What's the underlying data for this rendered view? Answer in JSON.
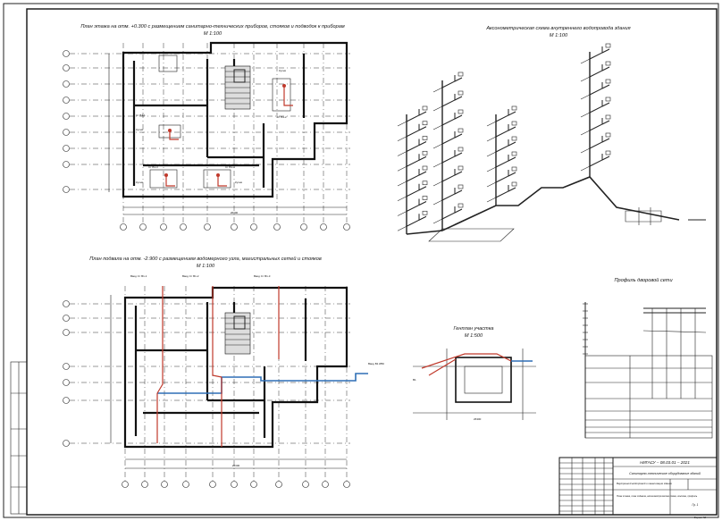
{
  "titles": {
    "floor_plan": "План этажа на отм. +0.300 с размещением санитарно-технических приборов, стояков и подводок к приборам",
    "axonometric": "Аксонометрическая схема внутреннего водопровода здания",
    "basement_plan": "План подвала на отм. -2.900 с размещением водомерного узла, магистральных сетей и стояков",
    "profile": "Профиль дворовой сети",
    "site_plan": "Генплан участка",
    "scale_100": "М 1:100",
    "scale_500": "М 1:500"
  },
  "title_block": {
    "code": "НИГАСУ – 08.03.01 – 2021",
    "subject": "Санитарно-техническое оборудование зданий",
    "part": "Внутренний водопровод и канализация здания",
    "contents": "План этажа, план подвала, аксонометрическая схема, генплан, профиль",
    "org": "Гр. 1",
    "format": "Формат А2"
  },
  "colors": {
    "risers": "#c0392b",
    "water_main": "#2e6fb5",
    "lines": "#222222"
  }
}
